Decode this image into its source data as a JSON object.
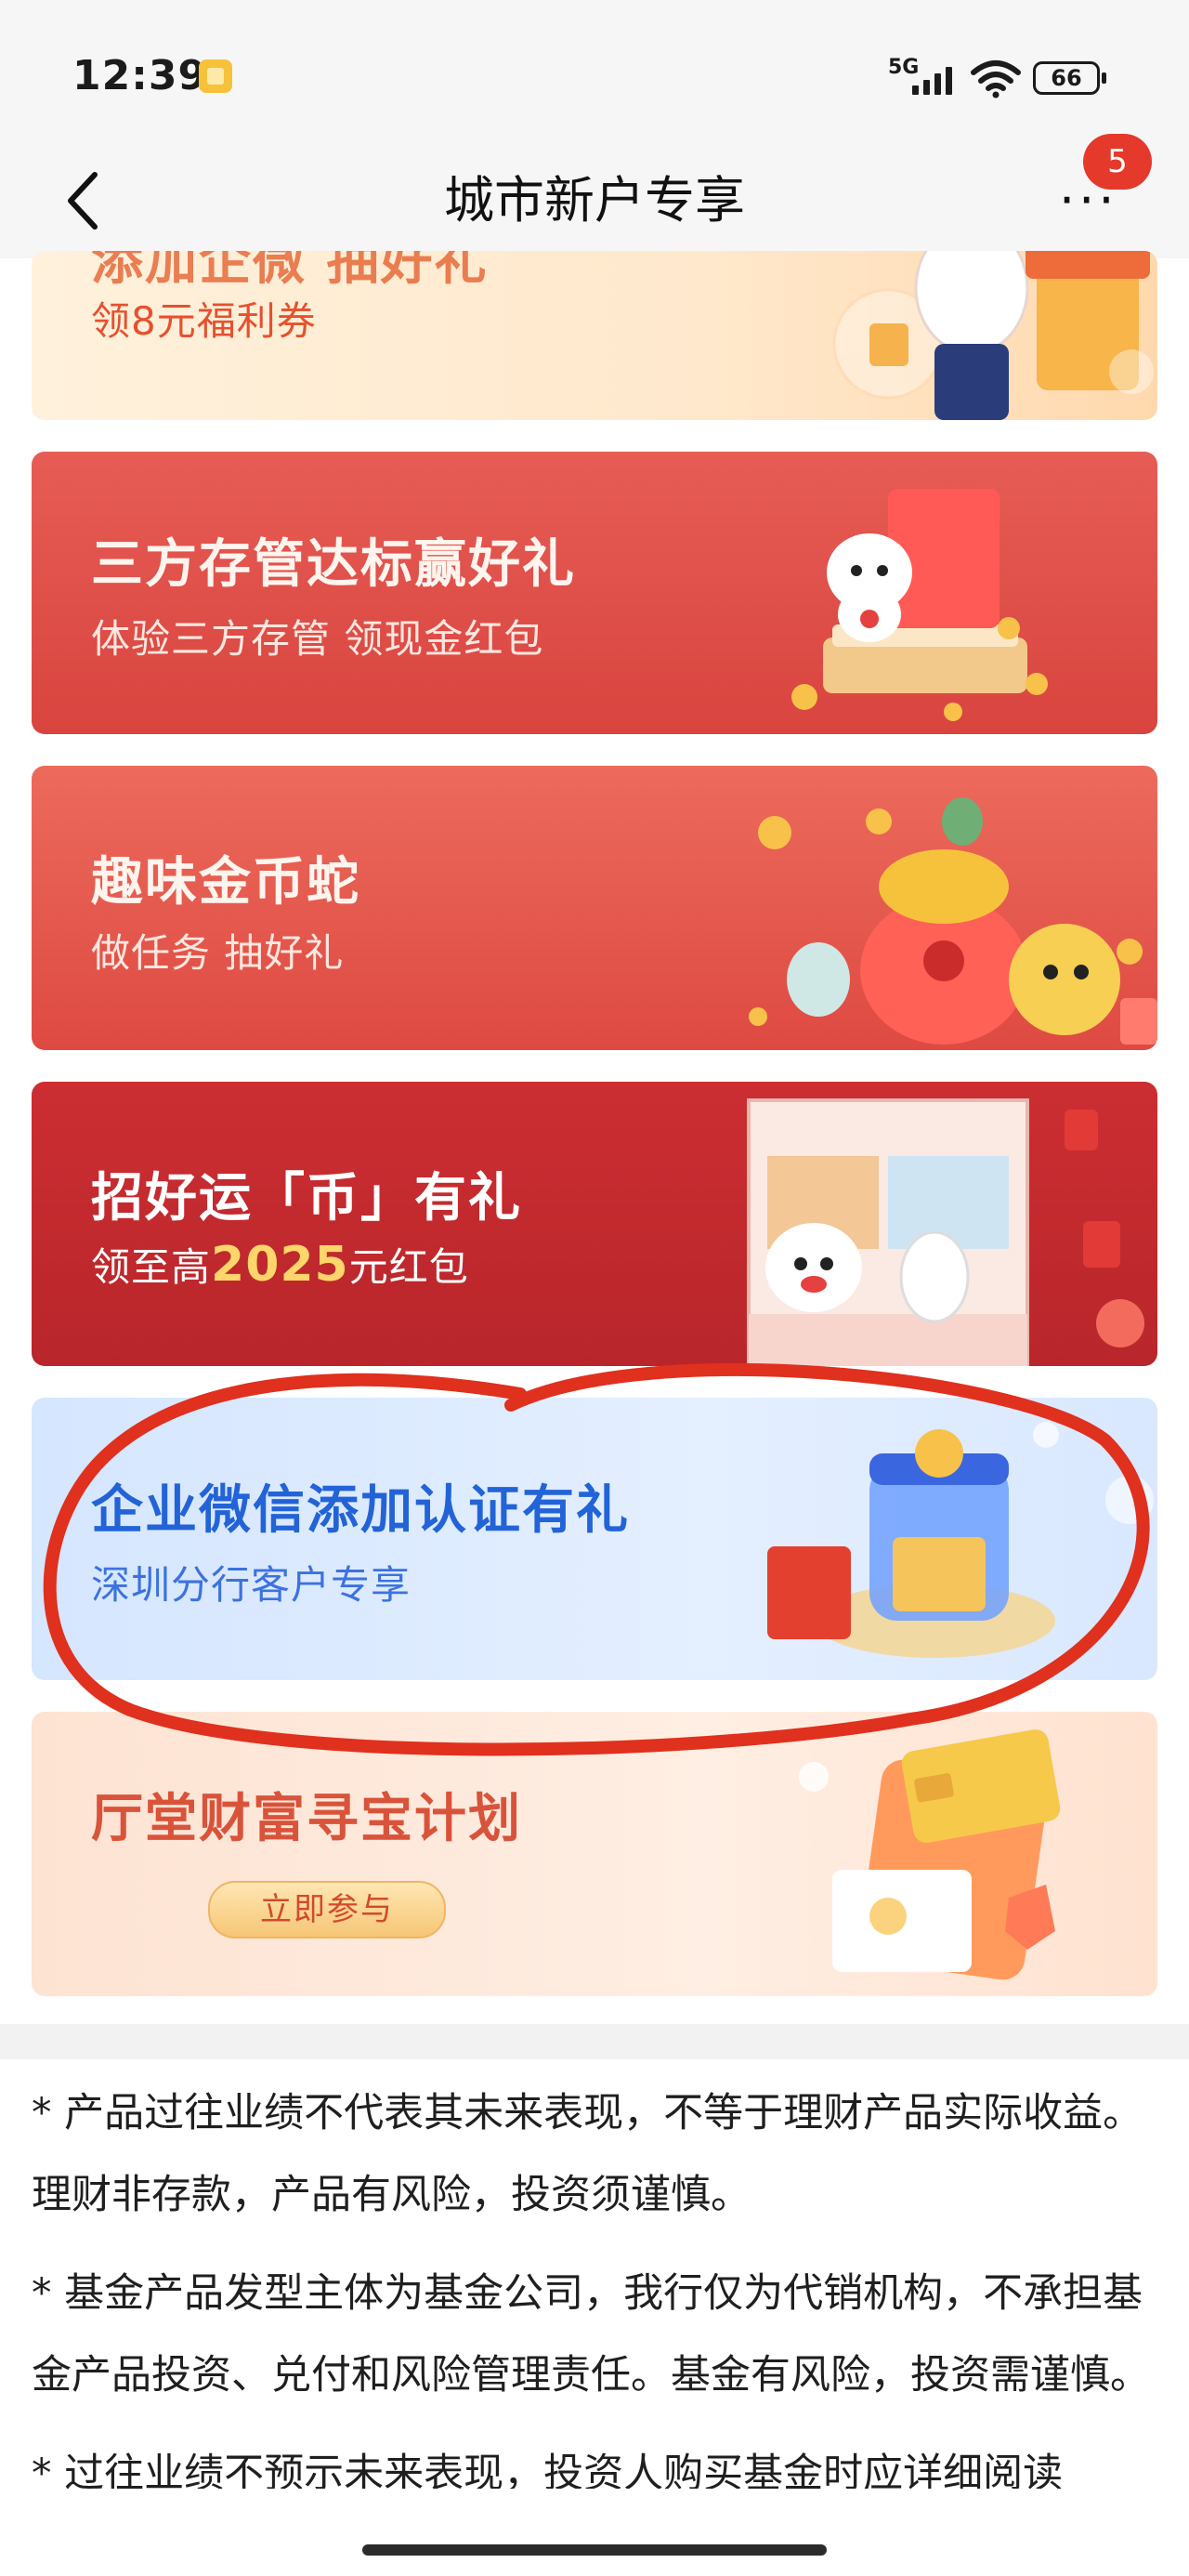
{
  "status_bar": {
    "time": "12:39",
    "network": "5G",
    "battery": "66"
  },
  "nav": {
    "title": "城市新户专享",
    "back_icon": "chevron-left-icon",
    "more_icon": "more-dots-icon",
    "badge": "5"
  },
  "cards": [
    {
      "title": "添加企微 抽好礼",
      "subtitle": "领8元福利券"
    },
    {
      "title": "三方存管达标赢好礼",
      "subtitle": "体验三方存管 领现金红包"
    },
    {
      "title": "趣味金币蛇",
      "subtitle": "做任务 抽好礼"
    },
    {
      "title": "招好运「币」有礼",
      "subtitle_prefix": "领至高",
      "subtitle_highlight": "2025",
      "subtitle_suffix": "元红包"
    },
    {
      "title": "企业微信添加认证有礼",
      "subtitle": "深圳分行客户专享"
    },
    {
      "title": "厅堂财富寻宝计划",
      "button": "立即参与"
    }
  ],
  "disclaimer": [
    "* 产品过往业绩不代表其未来表现，不等于理财产品实际收益。理财非存款，产品有风险，投资须谨慎。",
    "* 基金产品发型主体为基金公司，我行仅为代销机构，不承担基金产品投资、兑付和风险管理责任。基金有风险，投资需谨慎。",
    "* 过往业绩不预示未来表现，投资人购买基金时应详细阅读"
  ],
  "colors": {
    "accent_red": "#d9443f",
    "badge_red": "#e5392b",
    "annotation_red": "#e0301e",
    "blue_title": "#2363d8"
  }
}
